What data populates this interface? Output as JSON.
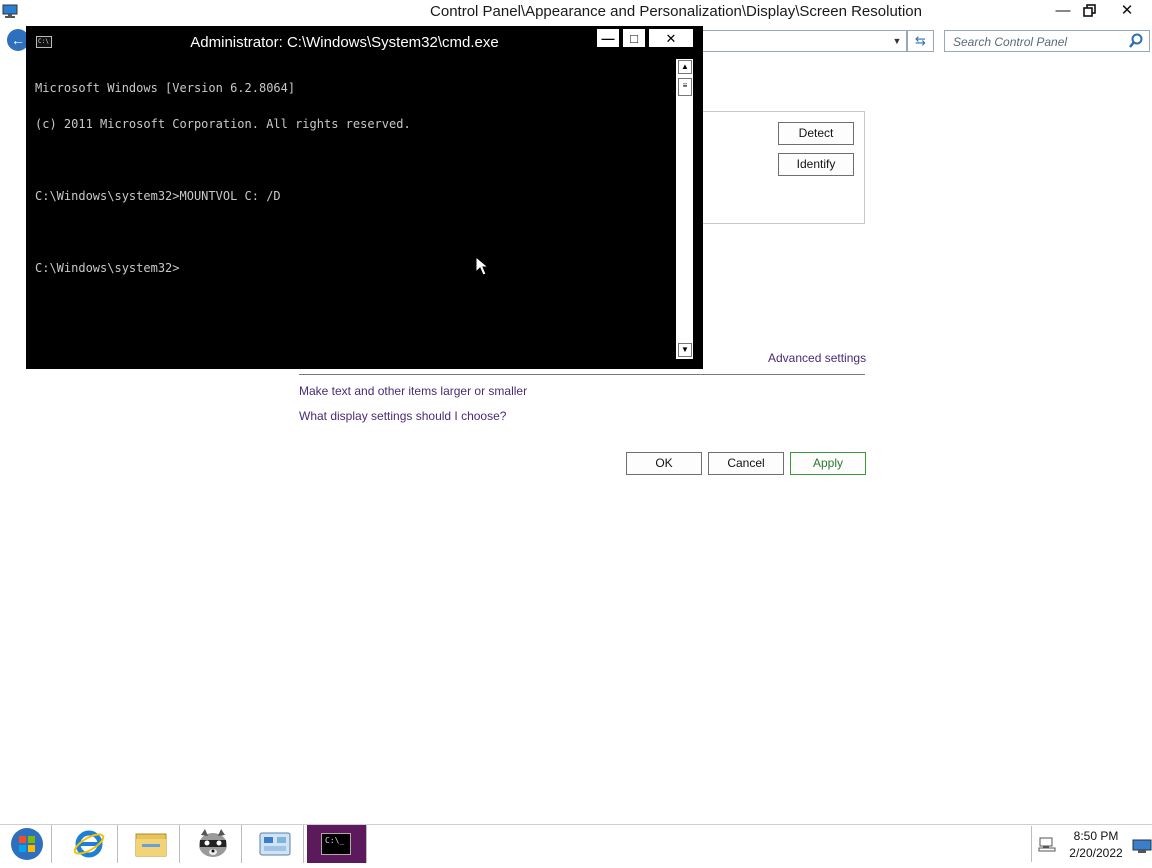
{
  "control_panel": {
    "title": "Control Panel\\Appearance and Personalization\\Display\\Screen Resolution",
    "search_placeholder": "Search Control Panel",
    "detect_label": "Detect",
    "identify_label": "Identify",
    "advanced_settings": "Advanced settings",
    "link_text_size": "Make text and other items larger or smaller",
    "link_display_help": "What display settings should I choose?",
    "ok_label": "OK",
    "cancel_label": "Cancel",
    "apply_label": "Apply"
  },
  "cmd": {
    "title": "Administrator: C:\\Windows\\System32\\cmd.exe",
    "icon_text": "C:\\",
    "lines": [
      "Microsoft Windows [Version 6.2.8064]",
      "(c) 2011 Microsoft Corporation. All rights reserved.",
      "",
      "C:\\Windows\\system32>MOUNTVOL C: /D",
      "",
      "C:\\Windows\\system32>"
    ]
  },
  "taskbar": {
    "time": "8:50 PM",
    "date": "2/20/2022",
    "cmd_button_text": "C:\\_"
  },
  "colors": {
    "cmd_taskbar_active": "#5c1a5c",
    "link": "#4b2a75",
    "apply_border": "#3a9a3a"
  }
}
